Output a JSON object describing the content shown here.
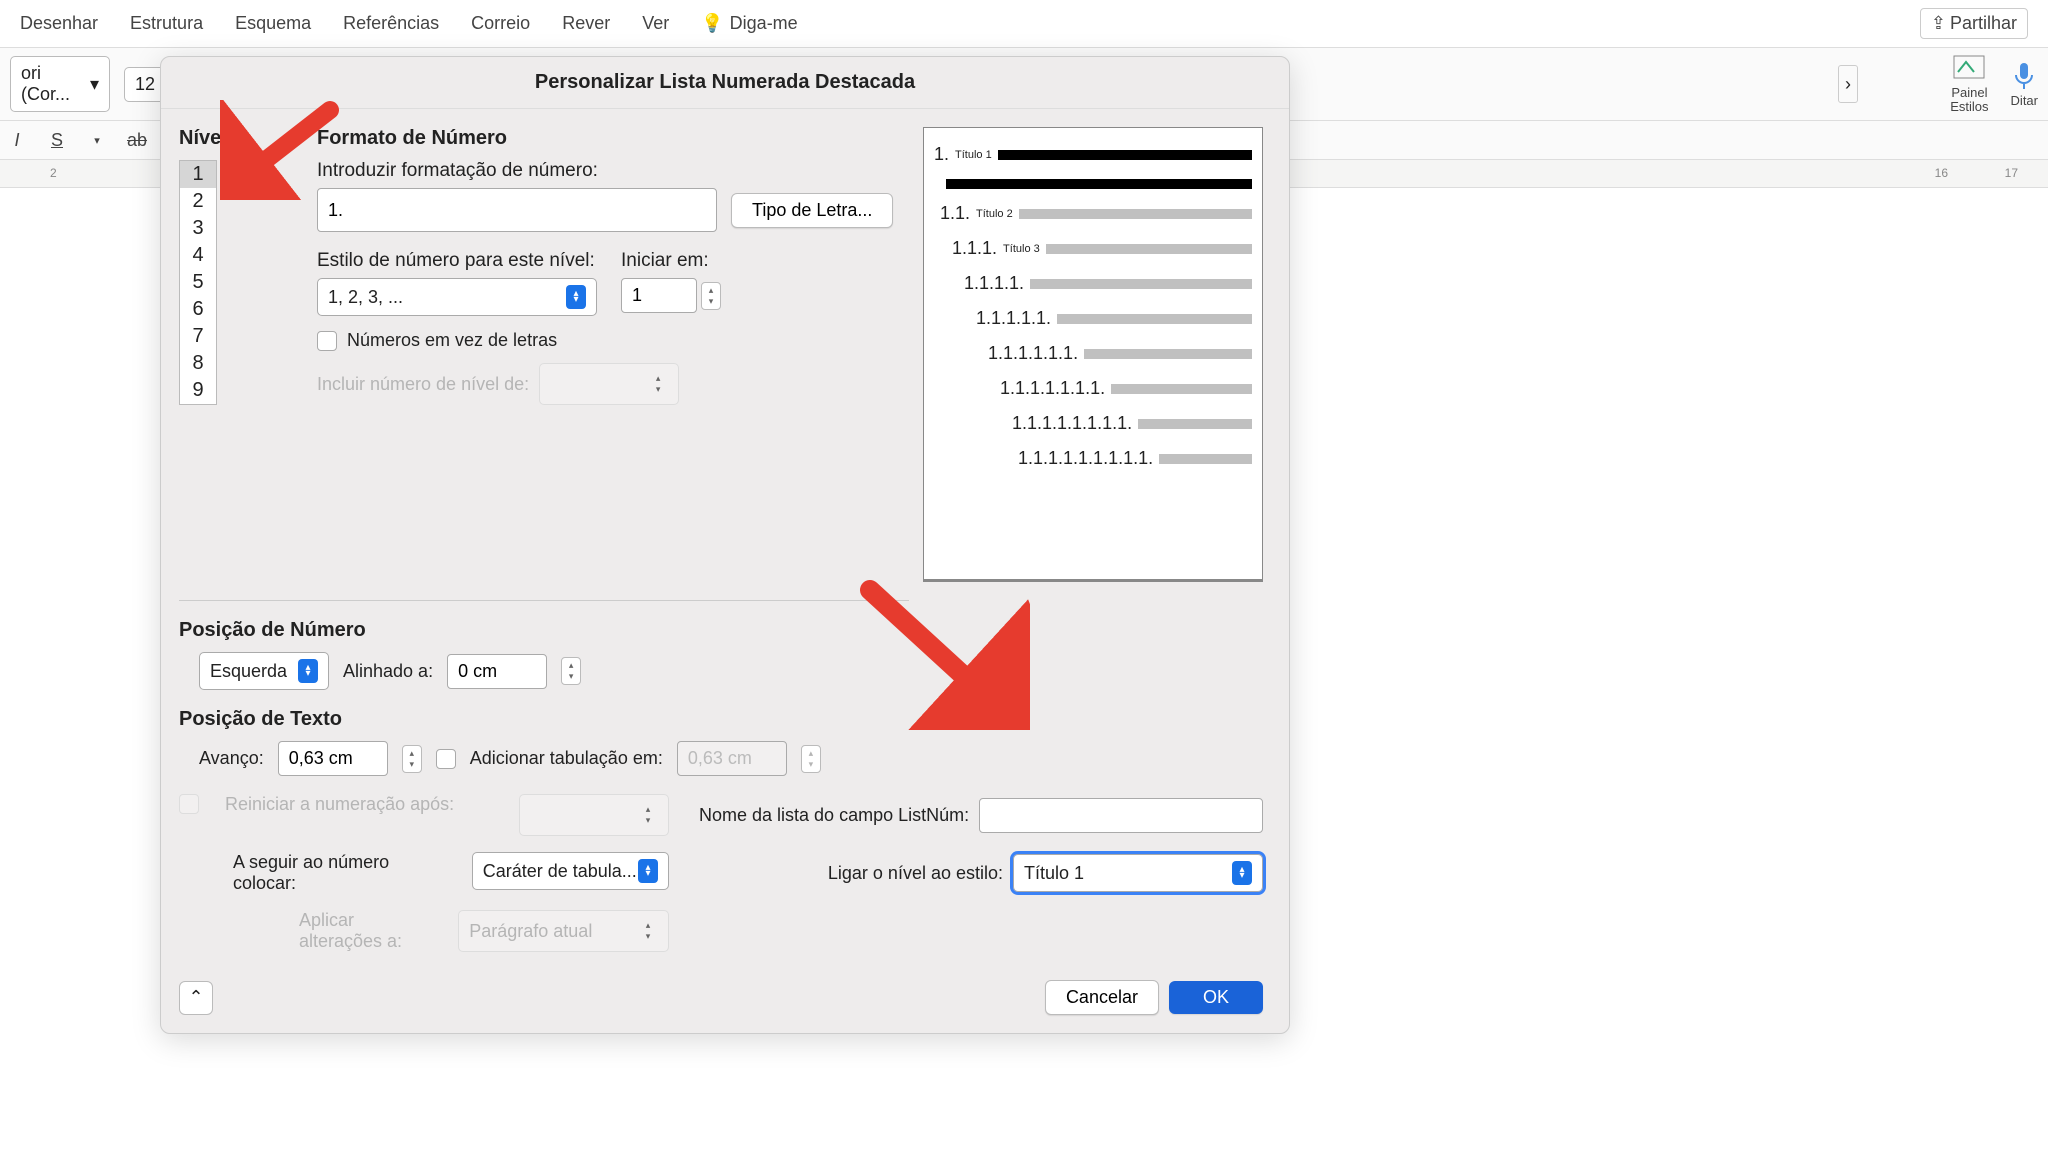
{
  "menu": {
    "items": [
      "Desenhar",
      "Estrutura",
      "Esquema",
      "Referências",
      "Correio",
      "Rever",
      "Ver"
    ],
    "tellme": "Diga-me",
    "share": "Partilhar"
  },
  "toolbar": {
    "font": "ori (Cor...",
    "size": "12",
    "panel": "Painel\nEstilos",
    "dictate": "Ditar"
  },
  "ruler": {
    "left": "2",
    "right1": "16",
    "right2": "17"
  },
  "dialog": {
    "title": "Personalizar Lista Numerada Destacada",
    "level_heading": "Nível",
    "levels": [
      "1",
      "2",
      "3",
      "4",
      "5",
      "6",
      "7",
      "8",
      "9"
    ],
    "format_heading": "Formato de Número",
    "enter_format": "Introduzir formatação de número:",
    "format_value": "1.",
    "font_btn": "Tipo de Letra...",
    "style_label": "Estilo de número para este nível:",
    "start_label": "Iniciar em:",
    "style_value": "1, 2, 3, ...",
    "start_value": "1",
    "numbers_letters": "Números em vez de letras",
    "include_level": "Incluir número de nível de:",
    "pos_num": "Posição de Número",
    "align_value": "Esquerda",
    "aligned_at": "Alinhado a:",
    "aligned_val": "0 cm",
    "pos_text": "Posição de Texto",
    "indent": "Avanço:",
    "indent_val": "0,63 cm",
    "add_tab": "Adicionar tabulação em:",
    "tab_val": "0,63 cm",
    "restart": "Reiniciar a numeração após:",
    "follow": "A seguir ao número colocar:",
    "follow_val": "Caráter de tabula...",
    "apply": "Aplicar alterações a:",
    "apply_val": "Parágrafo atual",
    "list_name": "Nome da lista do campo ListNúm:",
    "link_style": "Ligar o nível ao estilo:",
    "link_val": "Título 1",
    "cancel": "Cancelar",
    "ok": "OK",
    "preview": {
      "rows": [
        {
          "num": "1.",
          "lbl": "Título 1",
          "indent": 0,
          "dark": true
        },
        {
          "num": "",
          "lbl": "",
          "indent": 12,
          "dark": true
        },
        {
          "num": "1.1.",
          "lbl": "Título 2",
          "indent": 6
        },
        {
          "num": "1.1.1.",
          "lbl": "Título 3",
          "indent": 18
        },
        {
          "num": "1.1.1.1.",
          "lbl": "",
          "indent": 30
        },
        {
          "num": "1.1.1.1.1.",
          "lbl": "",
          "indent": 42
        },
        {
          "num": "1.1.1.1.1.1.",
          "lbl": "",
          "indent": 54
        },
        {
          "num": "1.1.1.1.1.1.1.",
          "lbl": "",
          "indent": 66
        },
        {
          "num": "1.1.1.1.1.1.1.1.",
          "lbl": "",
          "indent": 78
        },
        {
          "num": "1.1.1.1.1.1.1.1.1.",
          "lbl": "",
          "indent": 84
        }
      ]
    }
  }
}
